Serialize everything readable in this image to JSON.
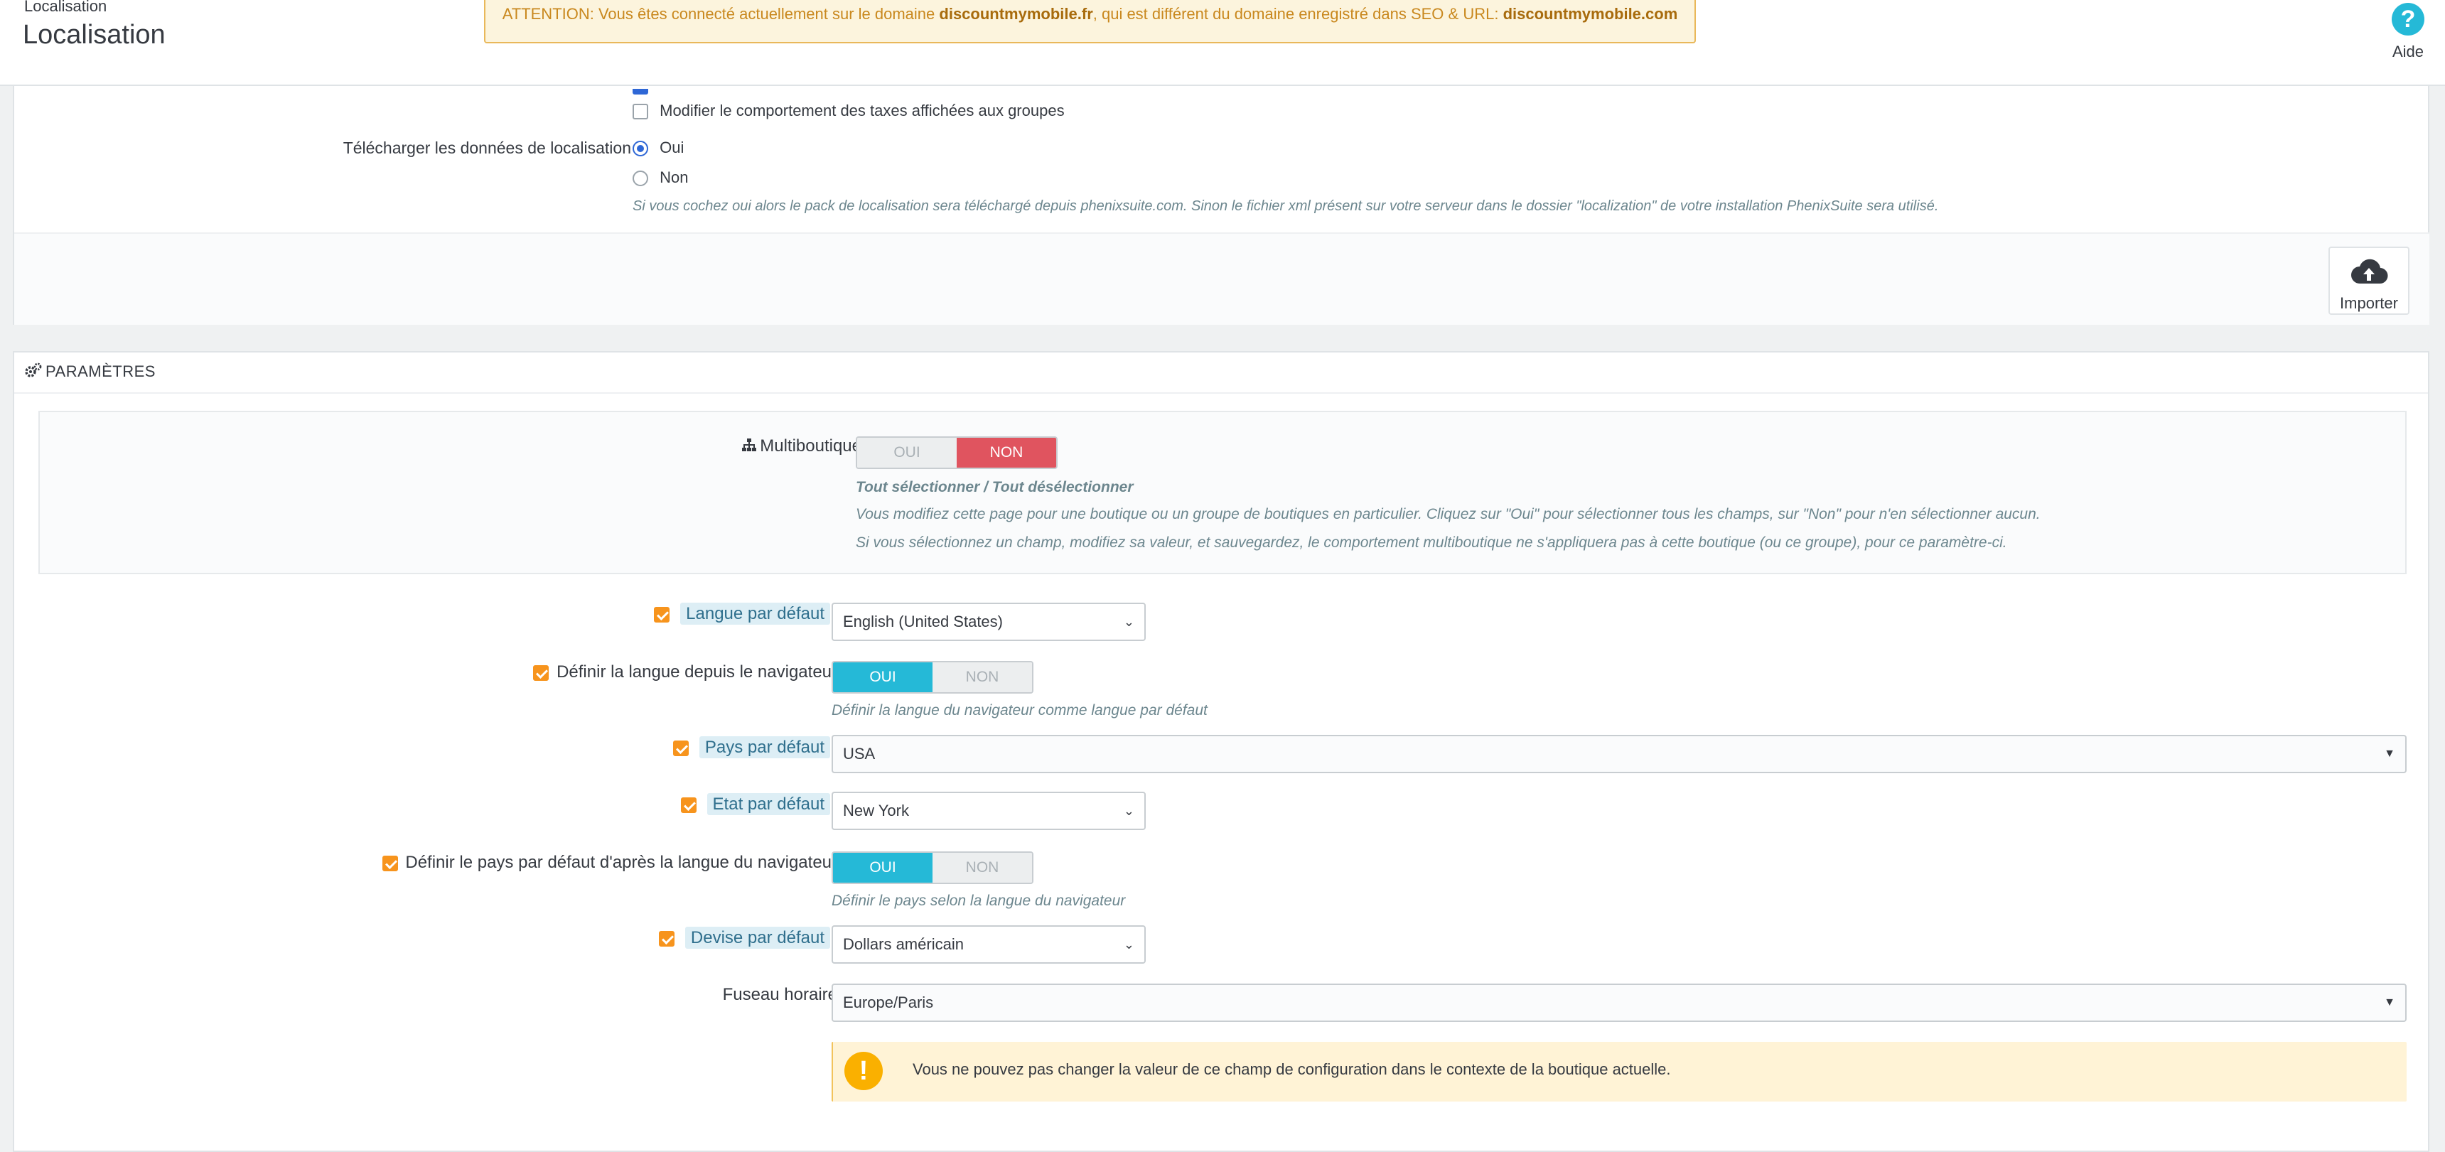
{
  "header": {
    "breadcrumb": "Localisation",
    "title": "Localisation",
    "warning": {
      "prefix": "ATTENTION: Vous êtes connecté actuellement sur le domaine ",
      "domain1": "discountmymobile.fr",
      "middle": ", qui est différent du domaine enregistré dans SEO & URL: ",
      "domain2": "discountmymobile.com"
    },
    "help_label": "Aide"
  },
  "import_panel": {
    "checkbox_taxes_label": "Modifier le comportement des taxes affichées aux groupes",
    "download_label": "Télécharger les données de localisation",
    "radio_oui": "Oui",
    "radio_non": "Non",
    "download_help": "Si vous cochez oui alors le pack de localisation sera téléchargé depuis phenixsuite.com. Sinon le fichier xml présent sur votre serveur dans le dossier \"localization\" de votre installation PhenixSuite sera utilisé.",
    "import_button": "Importer"
  },
  "params_panel": {
    "heading": "PARAMÈTRES",
    "multishop": {
      "label": "Multiboutique",
      "oui": "OUI",
      "non": "NON",
      "select_all": "Tout sélectionner / Tout désélectionner",
      "help1": "Vous modifiez cette page pour une boutique ou un groupe de boutiques en particulier. Cliquez sur \"Oui\" pour sélectionner tous les champs, sur \"Non\" pour n'en sélectionner aucun.",
      "help2": "Si vous sélectionnez un champ, modifiez sa valeur, et sauvegardez, le comportement multiboutique ne s'appliquera pas à cette boutique (ou ce groupe), pour ce paramètre-ci."
    },
    "fields": {
      "default_language": {
        "label": "Langue par défaut",
        "value": "English (United States)"
      },
      "browser_language": {
        "label": "Définir la langue depuis le navigateur",
        "oui": "OUI",
        "non": "NON",
        "help": "Définir la langue du navigateur comme langue par défaut"
      },
      "default_country": {
        "label": "Pays par défaut",
        "value": "USA"
      },
      "default_state": {
        "label": "Etat par défaut",
        "value": "New York"
      },
      "country_from_browser": {
        "label": "Définir le pays par défaut d'après la langue du navigateur",
        "oui": "OUI",
        "non": "NON",
        "help": "Définir le pays selon la langue du navigateur"
      },
      "default_currency": {
        "label": "Devise par défaut",
        "value": "Dollars américain"
      },
      "timezone": {
        "label": "Fuseau horaire",
        "value": "Europe/Paris"
      }
    },
    "alert": {
      "icon": "!",
      "text": "Vous ne pouvez pas changer la valeur de ce champ de configuration dans le contexte de la boutique actuelle."
    }
  },
  "colors": {
    "accent_blue": "#25b9d7",
    "danger_red": "#e0545f",
    "checkbox_orange": "#f7941d",
    "warning_bg": "#fcf4dd"
  },
  "icons": {
    "help": "question-circle-icon",
    "cloud": "cloud-upload-icon",
    "gears": "gears-icon",
    "sitemap": "sitemap-icon",
    "alert": "exclamation-circle-icon"
  }
}
